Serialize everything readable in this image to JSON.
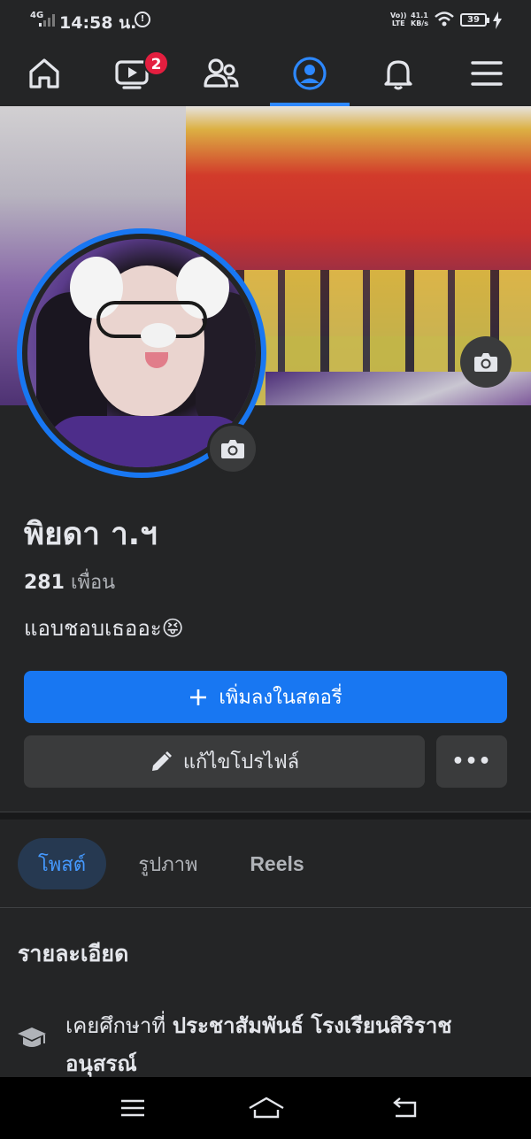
{
  "status_bar": {
    "network": "4G",
    "time": "14:58 น.",
    "lte_top": "Vo))",
    "lte_bottom": "LTE",
    "speed_top": "41.1",
    "speed_bottom": "KB/s",
    "battery": "39"
  },
  "nav": {
    "watch_badge": "2",
    "active_tab": "profile"
  },
  "profile": {
    "name": "พิยดา า.ฯ",
    "friends_count": "281",
    "friends_label": "เพื่อน",
    "bio": "แอบชอบเธออะ😝"
  },
  "actions": {
    "add_story_label": "เพิ่มลงในสตอรี่",
    "edit_profile_label": "แก้ไขโปรไฟล์",
    "more_label": "•••"
  },
  "tabs": [
    {
      "label": "โพสต์"
    },
    {
      "label": "รูปภาพ"
    },
    {
      "label": "Reels"
    }
  ],
  "details": {
    "title": "รายละเอียด",
    "education_prefix": "เคยศึกษาที่ ",
    "education_school": "ประชาสัมพันธ์ โรงเรียนสิริราชอนุสรณ์"
  },
  "colors": {
    "accent": "#1877f2",
    "background": "#242526",
    "badge": "#e41e3f"
  }
}
